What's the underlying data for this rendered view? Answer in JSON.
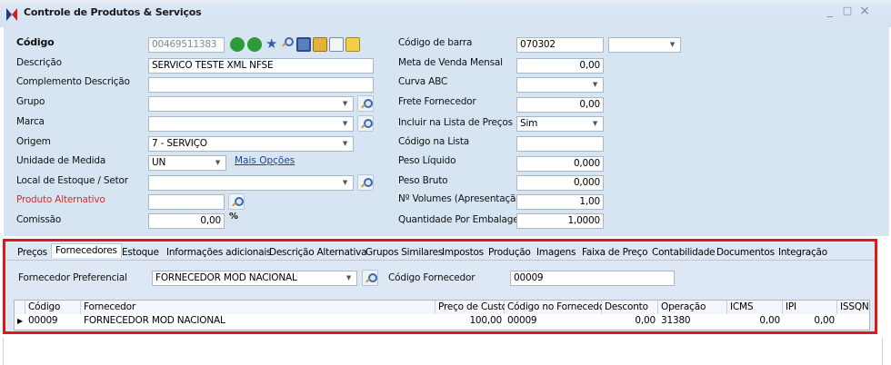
{
  "window": {
    "title": "Controle de Produtos & Serviços",
    "minimize": "_",
    "maximize": "□",
    "close": "×"
  },
  "left": {
    "codigo": {
      "label": "Código",
      "value": "00469511383"
    },
    "descricao": {
      "label": "Descrição",
      "value": "SERVICO TESTE XML NFSE"
    },
    "complemento": {
      "label": "Complemento Descrição",
      "value": ""
    },
    "grupo": {
      "label": "Grupo",
      "value": ""
    },
    "marca": {
      "label": "Marca",
      "value": ""
    },
    "origem": {
      "label": "Origem",
      "value": "7 - SERVIÇO"
    },
    "unidade": {
      "label": "Unidade de Medida",
      "value": "UN",
      "link": "Mais Opções"
    },
    "local": {
      "label": "Local de Estoque / Setor",
      "value": ""
    },
    "alternativo": {
      "label": "Produto Alternativo",
      "value": ""
    },
    "comissao": {
      "label": "Comissão",
      "value": "0,00",
      "symbol": "%"
    }
  },
  "right": {
    "barra": {
      "label": "Código de barra",
      "value": "070302"
    },
    "venda": {
      "label": "Meta de Venda Mensal",
      "value": "0,00"
    },
    "curva": {
      "label": "Curva ABC",
      "value": ""
    },
    "frete": {
      "label": "Frete Fornecedor",
      "value": "0,00"
    },
    "lista": {
      "label": "Incluir na Lista de Preços",
      "value": "Sim"
    },
    "codlista": {
      "label": "Código na Lista",
      "value": ""
    },
    "liquido": {
      "label": "Peso Líquido",
      "value": "0,000"
    },
    "bruto": {
      "label": "Peso Bruto",
      "value": "0,000"
    },
    "volumes": {
      "label": "Nº Volumes (Apresentação)",
      "value": "1,00"
    },
    "embalagem": {
      "label": "Quantidade Por Embalagem",
      "value": "1,0000"
    }
  },
  "tabs": [
    "Preços",
    "Fornecedores",
    "Estoque",
    "Informações adicionais",
    "Descrição Alternativa",
    "Grupos Similares",
    "Impostos",
    "Produção",
    "Imagens",
    "Faixa de Preço",
    "Contabilidade",
    "Documentos",
    "Integração"
  ],
  "fornecedor": {
    "pref_label": "Fornecedor Preferencial",
    "pref_value": "FORNECEDOR MOD NACIONAL",
    "cod_label": "Código Fornecedor",
    "cod_value": "00009"
  },
  "grid": {
    "headers": [
      "Código",
      "Fornecedor",
      "Preço de Custo",
      "Código no Fornecedor",
      "Desconto",
      "Operação",
      "ICMS",
      "IPI",
      "ISSQN"
    ],
    "row": {
      "indicator": "▶",
      "codigo": "00009",
      "fornecedor": "FORNECEDOR MOD NACIONAL",
      "preco": "100,00",
      "codforn": "00009",
      "desconto": "0,00",
      "operacao": "31380",
      "icms": "0,00",
      "ipi": "0,00",
      "issqn": ""
    }
  }
}
